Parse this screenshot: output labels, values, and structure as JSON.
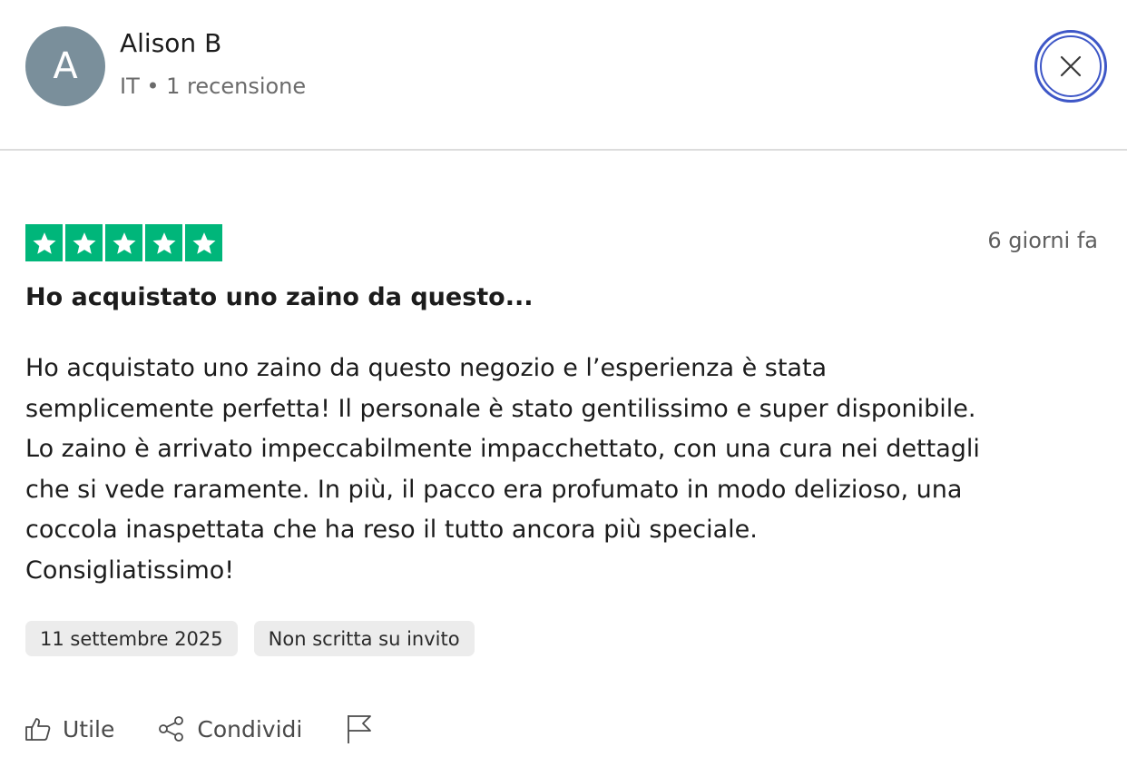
{
  "reviewer": {
    "avatar_initial": "A",
    "name": "Alison B",
    "meta": "IT • 1 recensione"
  },
  "review": {
    "rating": 5,
    "rating_max": 5,
    "relative_date": "6 giorni fa",
    "title": "Ho acquistato uno zaino da questo...",
    "body": "Ho acquistato uno zaino da questo negozio e l’esperienza è stata\nsemplicemente perfetta! Il personale è stato gentilissimo e super disponibile.\nLo zaino è arrivato impeccabilmente impacchettato, con una cura nei dettagli\nche si vede raramente. In più, il pacco era profumato in modo delizioso, una\ncoccola inaspettata che ha reso il tutto ancora più speciale.\nConsigliatissimo!",
    "tags": [
      "11 settembre 2025",
      "Non scritta su invito"
    ]
  },
  "actions": {
    "like_label": "Utile",
    "share_label": "Condividi"
  },
  "icons": {
    "close": "close-icon",
    "star": "star-icon",
    "like": "thumbs-up-icon",
    "share": "share-icon",
    "report": "flag-icon"
  },
  "colors": {
    "star_green": "#00b67a",
    "close_ring": "#3e57c7",
    "avatar_bg": "#7a8f9b"
  }
}
